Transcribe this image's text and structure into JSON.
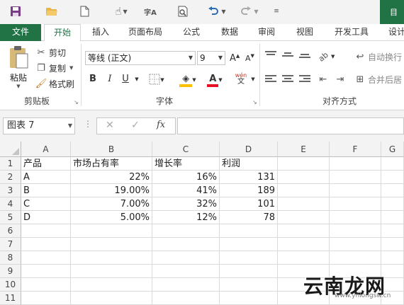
{
  "qat": {
    "save_icon": "save-icon",
    "open_icon": "folder-open-icon",
    "new_icon": "new-document-icon",
    "touch_icon": "touch-mode-icon",
    "spelling_icon": "spelling-icon",
    "preview_icon": "print-preview-icon",
    "undo_icon": "undo-icon",
    "redo_icon": "redo-icon",
    "customize_icon": "customize-qat-icon"
  },
  "tabs": [
    {
      "label": "文件"
    },
    {
      "label": "开始"
    },
    {
      "label": "插入"
    },
    {
      "label": "页面布局"
    },
    {
      "label": "公式"
    },
    {
      "label": "数据"
    },
    {
      "label": "审阅"
    },
    {
      "label": "视图"
    },
    {
      "label": "开发工具"
    },
    {
      "label": "设计"
    }
  ],
  "ribbon": {
    "clipboard": {
      "paste": "粘贴",
      "cut": "剪切",
      "copy": "复制",
      "format_painter": "格式刷",
      "group": "剪贴板"
    },
    "font": {
      "name": "等线 (正文)",
      "size": "9",
      "bold": "B",
      "italic": "I",
      "underline": "U",
      "grow": "A",
      "shrink": "A",
      "phonetic": "wén",
      "phonetic_sub": "文",
      "group": "字体"
    },
    "alignment": {
      "wrap": "自动换行",
      "merge": "合并后居",
      "group": "对齐方式"
    }
  },
  "formula_bar": {
    "name_box": "图表 7",
    "fx": "fx",
    "value": ""
  },
  "sheet": {
    "columns": [
      "A",
      "B",
      "C",
      "D",
      "E",
      "F",
      "G"
    ],
    "rows": [
      "1",
      "2",
      "3",
      "4",
      "5",
      "6",
      "7",
      "8",
      "9",
      "10",
      "11"
    ],
    "cells": [
      [
        "产品",
        "市场占有率",
        "增长率",
        "利润"
      ],
      [
        "A",
        "22%",
        "16%",
        "131"
      ],
      [
        "B",
        "19.00%",
        "41%",
        "189"
      ],
      [
        "C",
        "7.00%",
        "32%",
        "101"
      ],
      [
        "D",
        "5.00%",
        "12%",
        "78"
      ]
    ]
  },
  "watermark": {
    "text": "云南龙网",
    "sub": "www.ynlongsw.cn"
  },
  "colors": {
    "excel_green": "#217346",
    "font_color": "#e81123",
    "fill_color": "#ffc000"
  }
}
